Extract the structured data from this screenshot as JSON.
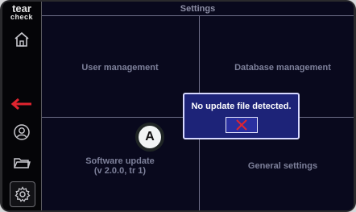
{
  "logo": {
    "line1": "tear",
    "line2": "check"
  },
  "sidebar": {
    "items": [
      {
        "name": "home",
        "icon": "home-icon"
      },
      {
        "name": "back",
        "icon": "back-arrow-icon",
        "color": "#e0242f"
      },
      {
        "name": "user",
        "icon": "user-icon"
      },
      {
        "name": "folder",
        "icon": "folder-icon"
      },
      {
        "name": "settings",
        "icon": "gear-icon"
      }
    ]
  },
  "settings": {
    "title": "Settings",
    "user_management": "User management",
    "database_management": "Database management",
    "software_update_line1": "Software update",
    "software_update_line2": "(v 2.0.0, tr 1)",
    "general_settings": "General settings"
  },
  "dialog": {
    "message": "No update file detected.",
    "close_icon": "close-icon",
    "close_color": "#e0242f"
  },
  "callout": {
    "label": "A"
  }
}
